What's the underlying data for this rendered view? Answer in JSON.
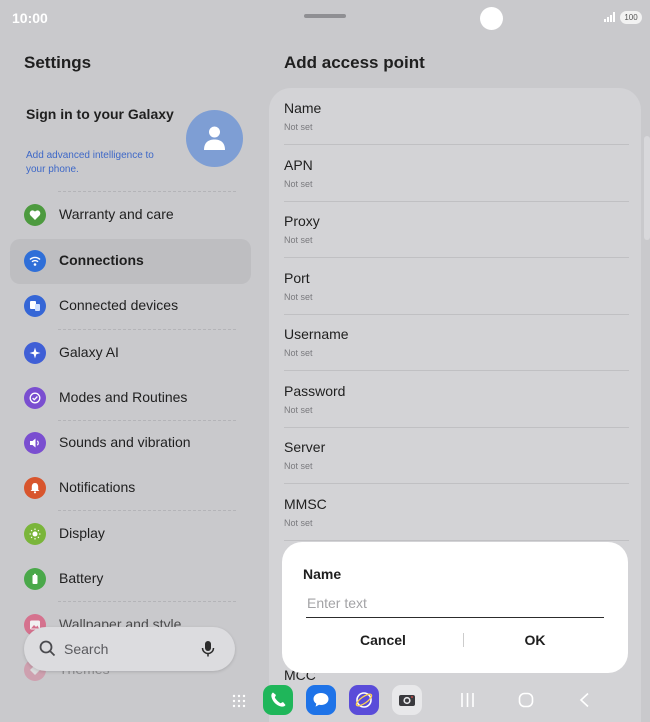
{
  "status_bar": {
    "time": "10:00",
    "battery": "100"
  },
  "left": {
    "title": "Settings",
    "account": {
      "title": "Sign in to your Galaxy",
      "subtitle": "Add advanced intelligence to your phone."
    },
    "menu": [
      {
        "label": "Warranty and care",
        "icon": "heart-icon",
        "color": "#4d9a3f"
      },
      {
        "label": "Connections",
        "icon": "wifi-icon",
        "color": "#2f6fd8",
        "selected": true
      },
      {
        "label": "Connected devices",
        "icon": "devices-icon",
        "color": "#3566d6"
      },
      {
        "label": "Galaxy AI",
        "icon": "sparkle-icon",
        "color": "#3f5fd6"
      },
      {
        "label": "Modes and Routines",
        "icon": "check-circle-icon",
        "color": "#7a4ed0"
      },
      {
        "label": "Sounds and vibration",
        "icon": "speaker-icon",
        "color": "#7a4ed0"
      },
      {
        "label": "Notifications",
        "icon": "bell-icon",
        "color": "#d8552d"
      },
      {
        "label": "Display",
        "icon": "sun-icon",
        "color": "#7ab53a"
      },
      {
        "label": "Battery",
        "icon": "battery-icon",
        "color": "#4aa84a"
      },
      {
        "label": "Wallpaper and style",
        "icon": "image-icon",
        "color": "#d9557a"
      },
      {
        "label": "Themes",
        "icon": "themes-icon",
        "color": "#d9557a"
      }
    ],
    "search": {
      "placeholder": "Search"
    }
  },
  "right": {
    "title": "Add access point",
    "fields": [
      {
        "label": "Name",
        "value": "Not set"
      },
      {
        "label": "APN",
        "value": "Not set"
      },
      {
        "label": "Proxy",
        "value": "Not set"
      },
      {
        "label": "Port",
        "value": "Not set"
      },
      {
        "label": "Username",
        "value": "Not set"
      },
      {
        "label": "Password",
        "value": "Not set"
      },
      {
        "label": "Server",
        "value": "Not set"
      },
      {
        "label": "MMSC",
        "value": "Not set"
      },
      {
        "label": "MCC",
        "value": ""
      }
    ]
  },
  "dialog": {
    "title": "Name",
    "placeholder": "Enter text",
    "cancel": "Cancel",
    "ok": "OK"
  },
  "nav": {
    "apps": [
      {
        "name": "phone-app-icon",
        "color": "#1fb65a"
      },
      {
        "name": "messages-app-icon",
        "color": "#1e73e8"
      },
      {
        "name": "browser-app-icon",
        "color": "#5a4cd9"
      },
      {
        "name": "camera-app-icon",
        "color": "#e8e8ea"
      }
    ]
  }
}
